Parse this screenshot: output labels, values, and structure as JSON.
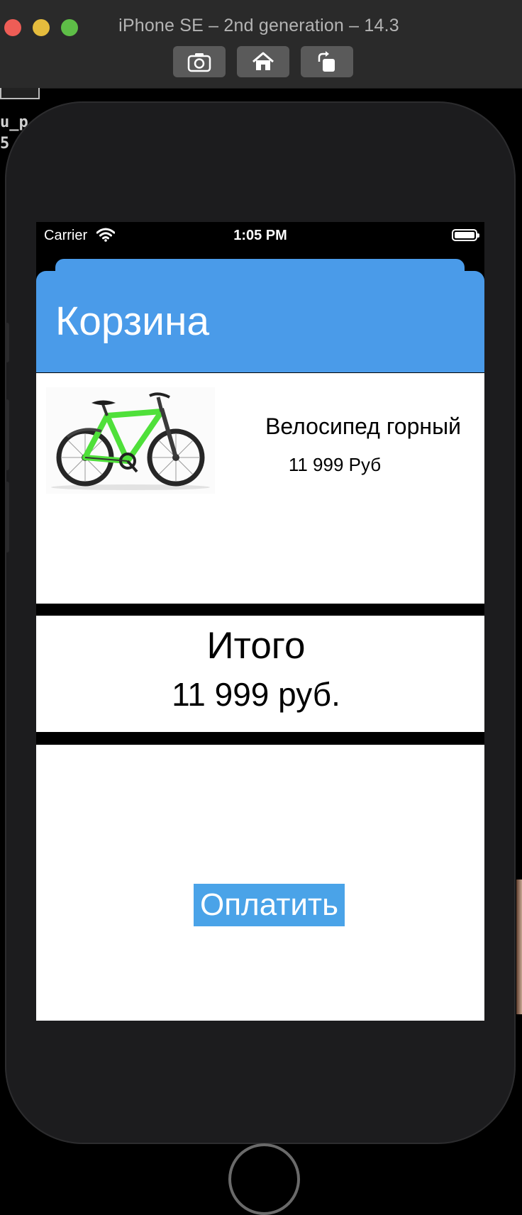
{
  "window": {
    "title": "iPhone SE – 2nd generation – 14.3",
    "toolbar": {
      "screenshot_icon": "camera-icon",
      "home_icon": "home-icon",
      "rotate_icon": "rotate-icon"
    }
  },
  "background_fragments": {
    "line1": "u_p",
    "line2": "5"
  },
  "status_bar": {
    "carrier": "Carrier",
    "time": "1:05 PM",
    "wifi_icon": "wifi-icon",
    "battery_icon": "battery-icon"
  },
  "nav": {
    "title": "Корзина"
  },
  "cart": {
    "items": [
      {
        "image_icon": "bicycle-image",
        "name": "Велосипед горный",
        "price": "11 999 Руб"
      }
    ]
  },
  "summary": {
    "label": "Итого",
    "value": "11 999 руб."
  },
  "actions": {
    "pay_label": "Оплатить"
  },
  "colors": {
    "accent": "#4a9be9",
    "pay_button": "#4aa3e8",
    "bike_green": "#4fe03a"
  }
}
